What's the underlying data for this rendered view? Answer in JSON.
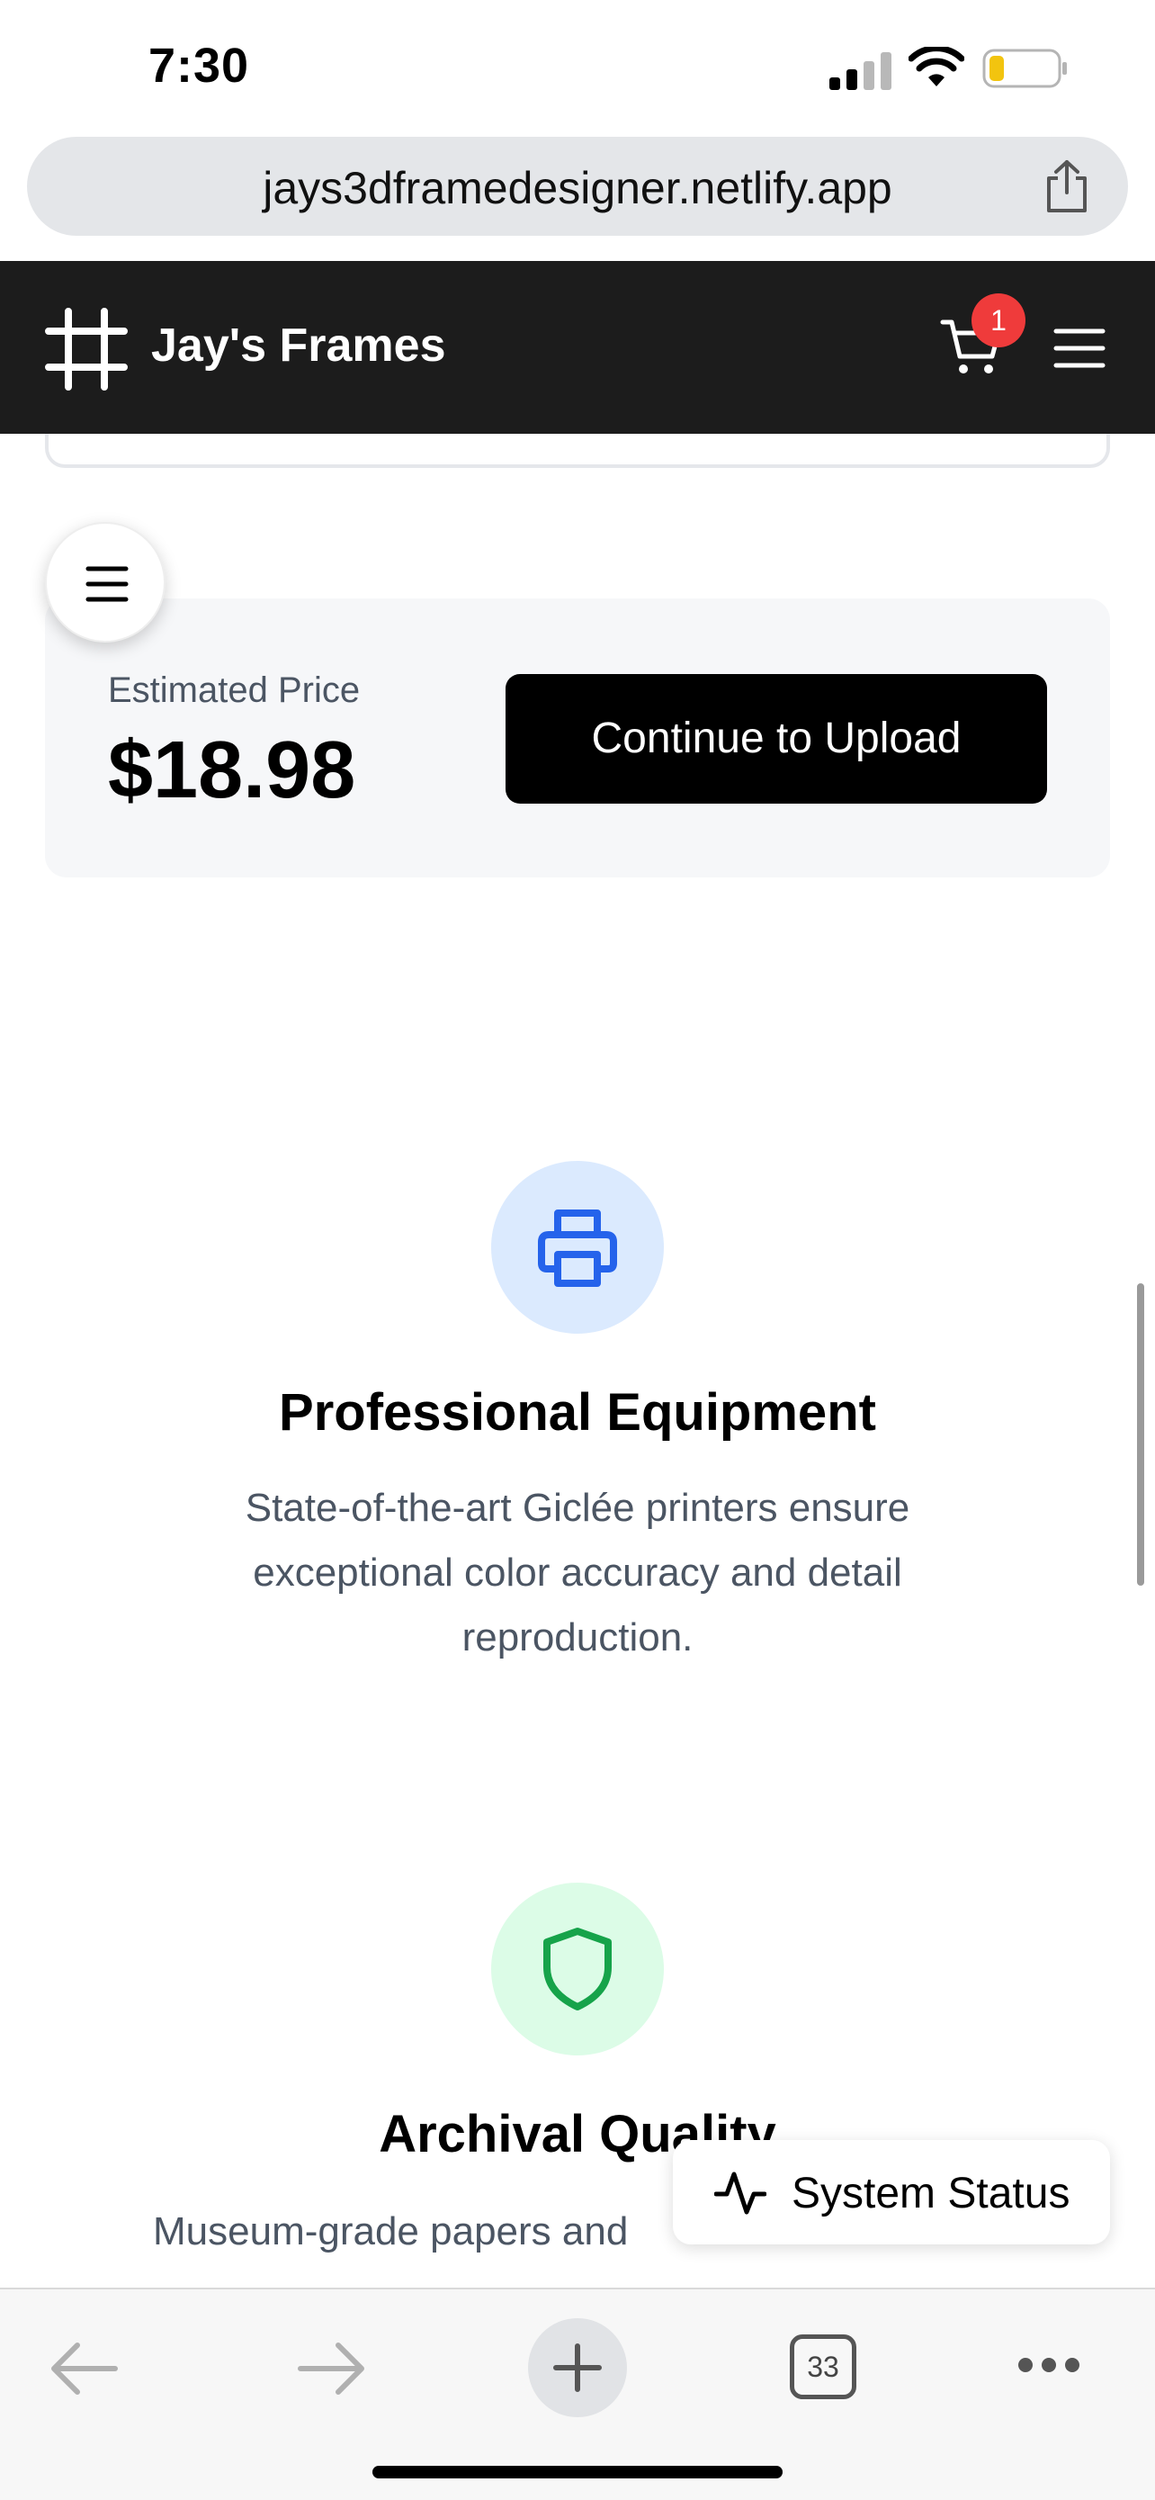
{
  "status_bar": {
    "time": "7:30"
  },
  "browser": {
    "url": "jays3dframedesigner.netlify.app",
    "tab_count": "33"
  },
  "header": {
    "brand": "Jay's Frames",
    "cart_count": "1"
  },
  "price_panel": {
    "label": "Estimated Price",
    "value": "$18.98",
    "button_label": "Continue to Upload"
  },
  "features": [
    {
      "icon": "printer-icon",
      "title": "Professional Equipment",
      "description": "State-of-the-art Giclée printers ensure exceptional color accuracy and detail reproduction."
    },
    {
      "icon": "shield-icon",
      "title": "Archival Quality",
      "description": "Museum-grade papers and"
    }
  ],
  "system_status": {
    "label": "System Status"
  },
  "colors": {
    "header_bg": "#1c1c1c",
    "badge": "#ef3b3b",
    "printer_accent": "#2563eb",
    "printer_bg": "#dbeafe",
    "shield_accent": "#16a34a",
    "shield_bg": "#dcfce7"
  }
}
